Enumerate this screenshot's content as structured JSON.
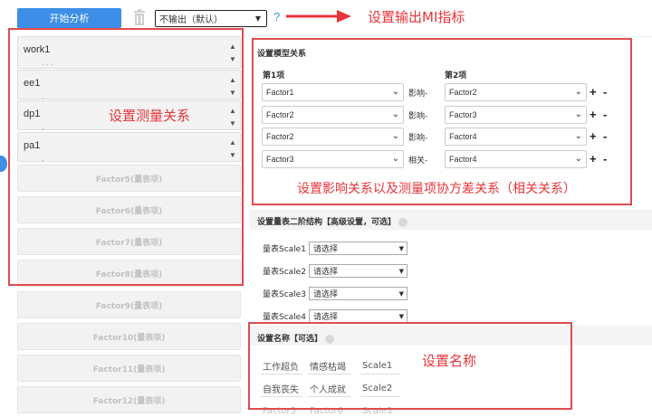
{
  "toolbar": {
    "start_label": "开始分析",
    "mi_value": "不输出（默认）",
    "help_glyph": "?"
  },
  "annotations": {
    "mi": "设置输出MI指标",
    "measure": "设置测量关系",
    "influence": "设置影响关系以及测量项协方差关系（相关关系）",
    "name": "设置名称"
  },
  "factors": [
    {
      "label": "work1",
      "sub": "- - -"
    },
    {
      "label": "ee1",
      "sub": "-"
    },
    {
      "label": "dp1",
      "sub": "-"
    },
    {
      "label": "pa1",
      "sub": "-"
    }
  ],
  "empty_factors": [
    "Factor5(量表项)",
    "Factor6(量表项)",
    "Factor7(量表项)",
    "Factor8(量表项)",
    "Factor9(量表项)",
    "Factor10(量表项)",
    "Factor11(量表项)",
    "Factor12(量表项)"
  ],
  "model": {
    "title": "设置模型关系",
    "col1": "第1项",
    "col2": "第2项",
    "plus": "+",
    "minus": "-",
    "rows": [
      {
        "left": "Factor1",
        "rel": "影响-",
        "right": "Factor2"
      },
      {
        "left": "Factor2",
        "rel": "影响-",
        "right": "Factor3"
      },
      {
        "left": "Factor2",
        "rel": "影响-",
        "right": "Factor4"
      },
      {
        "left": "Factor3",
        "rel": "相关-",
        "right": "Factor4"
      }
    ]
  },
  "second_order": {
    "title": "设置量表二阶结构【高级设置，可选】",
    "rows": [
      {
        "label": "量表Scale1",
        "value": "请选择"
      },
      {
        "label": "量表Scale2",
        "value": "请选择"
      },
      {
        "label": "量表Scale3",
        "value": "请选择"
      },
      {
        "label": "量表Scale4",
        "value": "请选择"
      }
    ]
  },
  "names": {
    "title": "设置名称【可选】",
    "rows": [
      [
        "工作超负",
        "情感枯竭",
        "Scale1"
      ],
      [
        "自我丧失",
        "个人成就",
        "Scale2"
      ],
      [
        "Factor5",
        "Factor6",
        "Scale3"
      ]
    ]
  },
  "colors": {
    "accent": "#3c8ee7",
    "annotation_red": "#e8343a"
  }
}
